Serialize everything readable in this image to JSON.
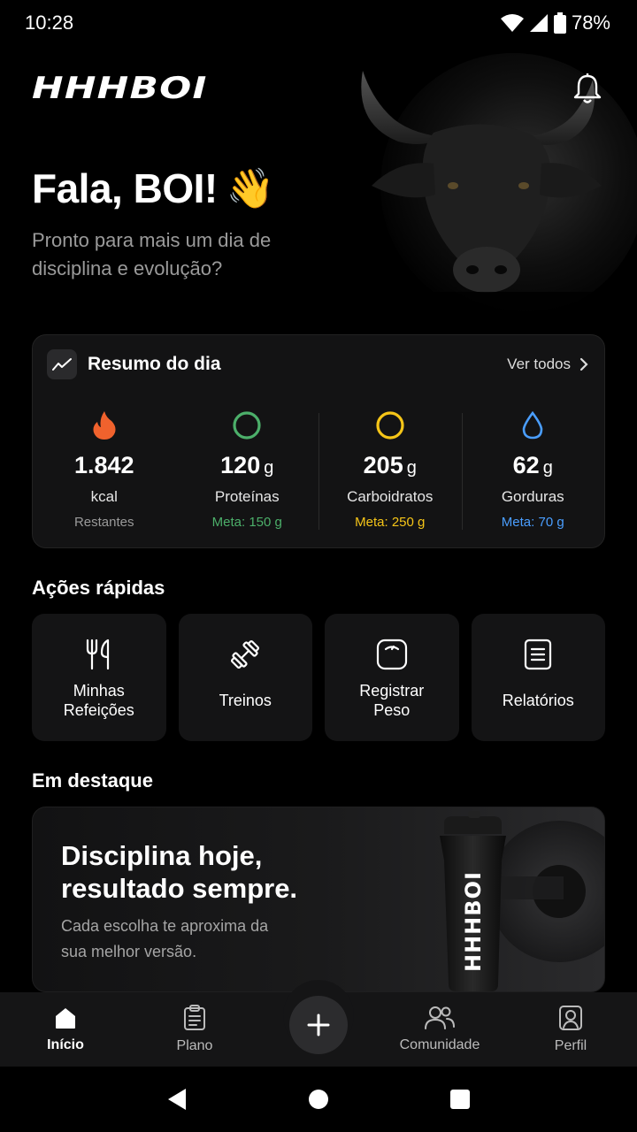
{
  "status_bar": {
    "time": "10:28",
    "battery": "78%"
  },
  "header": {
    "logo": "HHHBOI"
  },
  "greeting": {
    "title": "Fala, BOI!",
    "emoji": "👋",
    "subtitle": "Pronto para mais um dia de disciplina e evolução?"
  },
  "summary": {
    "title": "Resumo do dia",
    "see_all": "Ver todos",
    "stats": [
      {
        "value": "1.842",
        "unit": "",
        "label": "kcal",
        "meta": "Restantes",
        "color": "#9a9a9a",
        "icon": "fire-icon"
      },
      {
        "value": "120",
        "unit": "g",
        "label": "Proteínas",
        "meta": "Meta: 150 g",
        "color": "#4caf6a",
        "icon": "ring-icon"
      },
      {
        "value": "205",
        "unit": "g",
        "label": "Carboidratos",
        "meta": "Meta: 250 g",
        "color": "#f5c518",
        "icon": "ring-icon"
      },
      {
        "value": "62",
        "unit": "g",
        "label": "Gorduras",
        "meta": "Meta: 70 g",
        "color": "#4a9eff",
        "icon": "drop-icon"
      }
    ]
  },
  "quick_actions": {
    "title": "Ações rápidas",
    "items": [
      {
        "label": "Minhas\nRefeições",
        "icon": "fork-knife-icon"
      },
      {
        "label": "Treinos",
        "icon": "dumbbell-icon"
      },
      {
        "label": "Registrar\nPeso",
        "icon": "scale-icon"
      },
      {
        "label": "Relatórios",
        "icon": "report-icon"
      }
    ]
  },
  "featured": {
    "title": "Em destaque",
    "banner_title": "Disciplina hoje,\nresultado sempre.",
    "banner_text": "Cada escolha te aproxima da sua melhor versão.",
    "shaker_brand": "HHHBOI"
  },
  "bottom_nav": {
    "items": [
      {
        "label": "Início",
        "icon": "home-icon"
      },
      {
        "label": "Plano",
        "icon": "clipboard-icon"
      },
      {
        "label": "Comunidade",
        "icon": "community-icon"
      },
      {
        "label": "Perfil",
        "icon": "profile-icon"
      }
    ],
    "fab_icon": "plus-icon"
  }
}
